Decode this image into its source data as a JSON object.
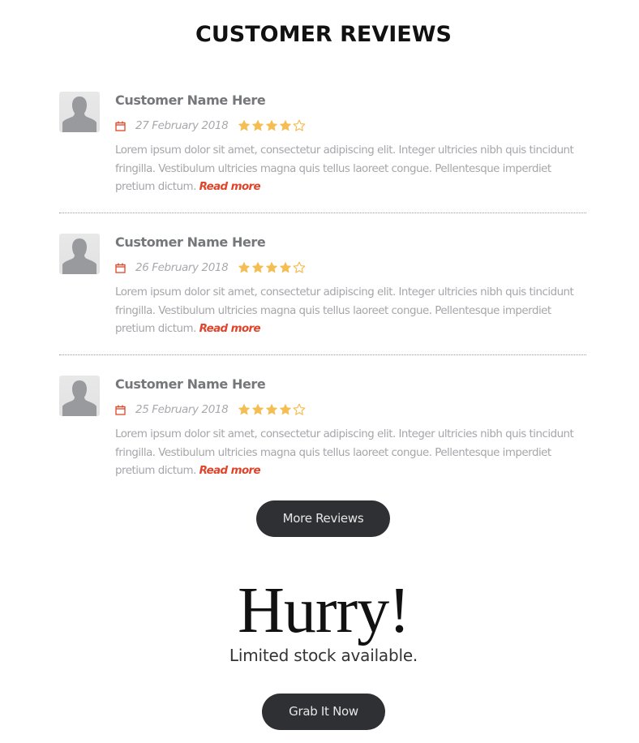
{
  "header": {
    "title": "CUSTOMER REVIEWS"
  },
  "reviews": [
    {
      "name": "Customer Name Here",
      "date": "27 February 2018",
      "rating": 4,
      "max_rating": 5,
      "text": "Lorem ipsum dolor sit amet, consectetur adipiscing elit. Integer ultricies nibh quis tincidunt fringilla. Vestibulum ultricies magna quis tellus laoreet congue. Pellentesque imperdiet pretium dictum.",
      "read_more": "Read more"
    },
    {
      "name": "Customer Name Here",
      "date": "26 February 2018",
      "rating": 4,
      "max_rating": 5,
      "text": "Lorem ipsum dolor sit amet, consectetur adipiscing elit. Integer ultricies nibh quis tincidunt fringilla. Vestibulum ultricies magna quis tellus laoreet congue. Pellentesque imperdiet pretium dictum.",
      "read_more": "Read more"
    },
    {
      "name": "Customer Name Here",
      "date": "25 February 2018",
      "rating": 4,
      "max_rating": 5,
      "text": "Lorem ipsum dolor sit amet, consectetur adipiscing elit. Integer ultricies nibh quis tincidunt fringilla. Vestibulum ultricies magna quis tellus laoreet congue. Pellentesque imperdiet pretium dictum.",
      "read_more": "Read more"
    }
  ],
  "more_reviews_button": {
    "label": "More Reviews"
  },
  "promo": {
    "headline": "Hurry!",
    "subtext": "Limited stock available.",
    "cta_label": "Grab It Now"
  },
  "icons": {
    "avatar": "user-silhouette-icon",
    "date": "calendar-icon",
    "star_filled": "star-filled-icon",
    "star_empty": "star-outline-icon"
  },
  "colors": {
    "accent": "#e0442a",
    "star": "#f5be53",
    "button_bg": "#2f3033",
    "name_text": "#76777b",
    "body_text": "#a5a6aa"
  }
}
